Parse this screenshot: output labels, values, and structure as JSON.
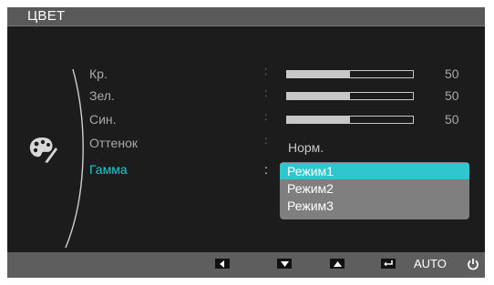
{
  "osd": {
    "title": "ЦВЕТ",
    "items": [
      {
        "label": "Кр.",
        "value": 50,
        "max": 100,
        "value_text": "50"
      },
      {
        "label": "Зел.",
        "value": 50,
        "max": 100,
        "value_text": "50"
      },
      {
        "label": "Син.",
        "value": 50,
        "max": 100,
        "value_text": "50"
      },
      {
        "label": "Оттенок",
        "value_text": "Норм."
      },
      {
        "label": "Гамма"
      }
    ],
    "colon": ":",
    "dropdown": {
      "options": [
        "Режим1",
        "Режим2",
        "Режим3"
      ],
      "selected_index": 0
    },
    "bottom_bar": {
      "buttons": [
        {
          "icon": "left-arrow-icon"
        },
        {
          "icon": "down-arrow-icon"
        },
        {
          "icon": "up-arrow-icon"
        },
        {
          "icon": "enter-icon"
        }
      ],
      "auto_label": "AUTO",
      "power_icon": "power-icon"
    },
    "colors": {
      "accent": "#22c7d5",
      "selected_bg": "#30c6cf",
      "panel": "#1c1c1c",
      "bar": "#5e5e5e"
    },
    "menu_icon": "palette-icon"
  }
}
